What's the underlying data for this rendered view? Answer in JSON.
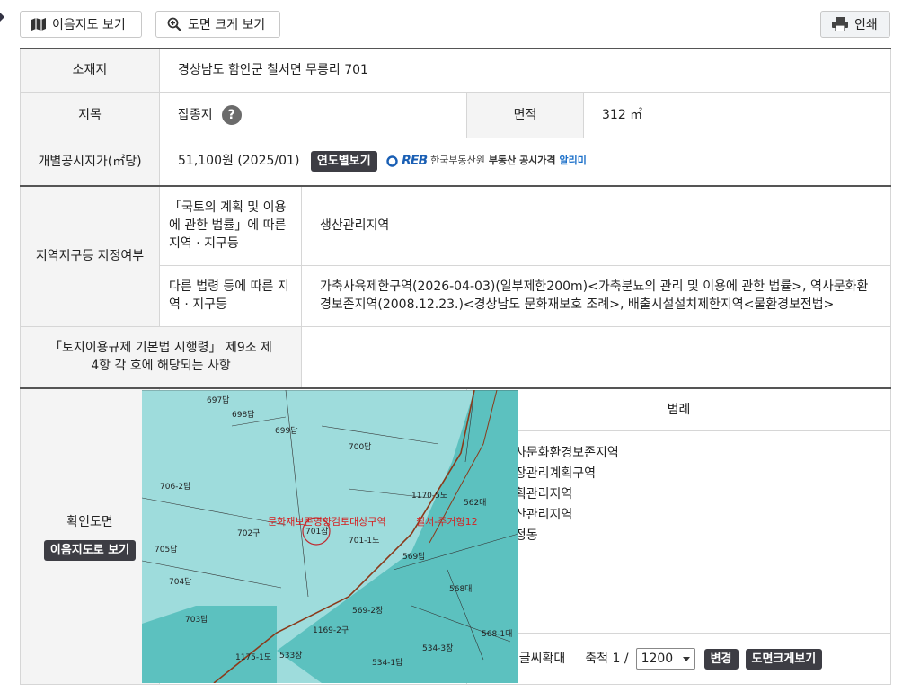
{
  "toolbar": {
    "map_button": "이음지도 보기",
    "zoom_button": "도면 크게 보기",
    "print_button": "인쇄"
  },
  "info": {
    "location_label": "소재지",
    "location_value": "경상남도 함안군 칠서면 무릉리 701",
    "jimok_label": "지목",
    "jimok_value": "잡종지",
    "help_symbol": "?",
    "area_label": "면적",
    "area_value": "312 ㎡",
    "price_label": "개별공시지가(㎡당)",
    "price_value": "51,100원 (2025/01)",
    "yearly_button": "연도별보기",
    "reb": {
      "logo": "REB",
      "org": "한국부동산원",
      "service_a": "부동산 공시가격",
      "service_b": "알리미"
    }
  },
  "zoning": {
    "label": "지역지구등 지정여부",
    "law1_label": "「국토의 계획 및 이용에 관한 법률」에 따른 지역 · 지구등",
    "law1_value": "생산관리지역",
    "law2_label": "다른 법령 등에 따른 지역 · 지구등",
    "law2_value": "가축사육제한구역(2026-04-03)(일부제한200m)<가축분뇨의 관리 및 이용에 관한 법률>, 역사문화환경보존지역(2008.12.23.)<경상남도 문화재보호 조례>, 배출시설설치제한지역<물환경보전법>",
    "enforcement_label": "「토지이용규제 기본법 시행령」 제9조 제4항 각 호에 해당되는 사항",
    "enforcement_value": ""
  },
  "map": {
    "label": "확인도면",
    "view_button": "이음지도로 보기",
    "parcels": [
      "697답",
      "698답",
      "699답",
      "700답",
      "701잡",
      "702구",
      "703답",
      "704답",
      "705답",
      "706-2답",
      "562대",
      "569답",
      "568대",
      "569-2장",
      "568-1대",
      "534-3장",
      "534-1답",
      "533장",
      "1170-5도",
      "1169-2구",
      "1175-1도",
      "701-1도"
    ],
    "overlay_labels": [
      "문화재보존영향검토대상구역",
      "칠서-주거형12"
    ]
  },
  "legend": {
    "title": "범례",
    "items": [
      {
        "label": "역사문화환경보존지역",
        "fill": "#ffffff",
        "border": "#c0272d"
      },
      {
        "label": "성장관리계획구역",
        "fill": "#ffffff",
        "border": "#8b6a4a"
      },
      {
        "label": "계획관리지역",
        "fill": "#5cc1bf",
        "border": "#5cc1bf"
      },
      {
        "label": "생산관리지역",
        "fill": "#9edcdc",
        "border": "#9edcdc"
      },
      {
        "label": "법정동",
        "fill": "#ffffff",
        "border": "#b09070"
      }
    ],
    "small_text": "작은글씨확대",
    "scale_label": "축척 1 /",
    "scale_value": "1200",
    "change_button": "변경",
    "enlarge_button": "도면크게보기"
  },
  "colors": {
    "map_light": "#9edcdc",
    "map_dark": "#5cc1bf",
    "dark_button": "#3d3d44"
  }
}
